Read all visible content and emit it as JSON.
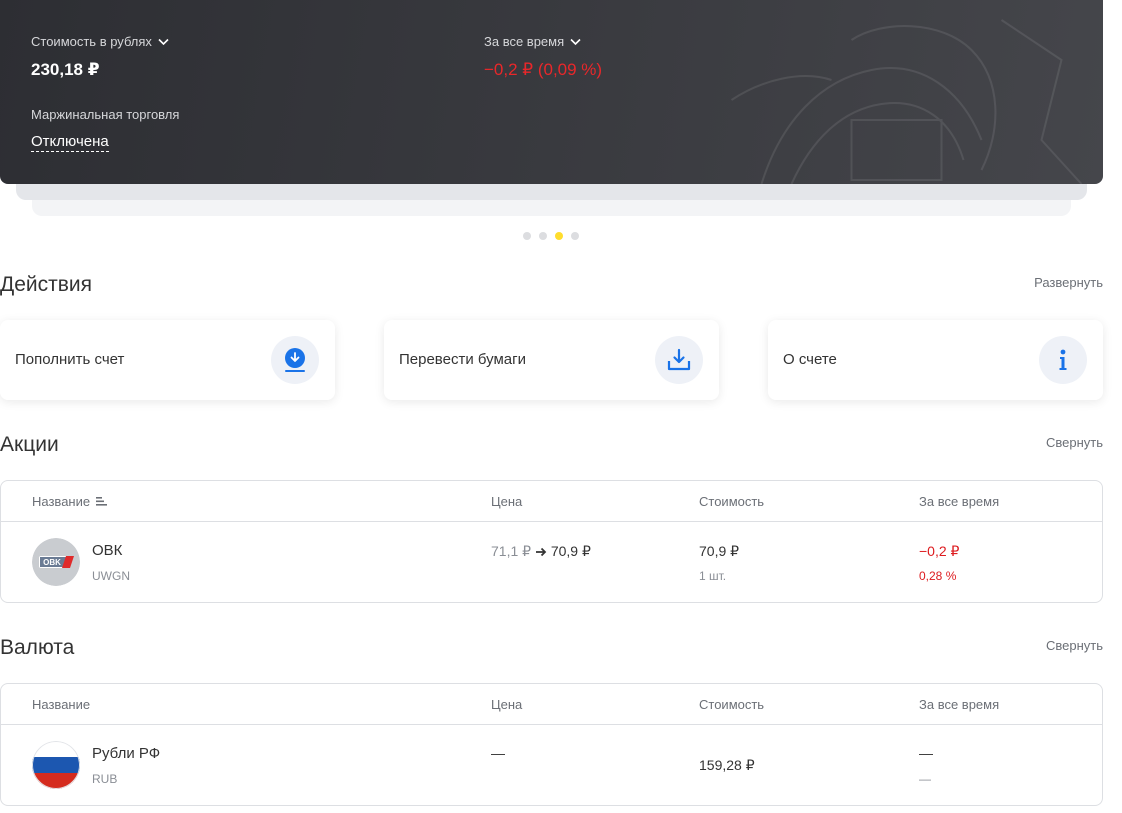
{
  "hero": {
    "value_label": "Стоимость в рублях",
    "value": "230,18 ₽",
    "period_label": "За все время",
    "period_change": "−0,2 ₽ (0,09 %)",
    "margin_label": "Маржинальная торговля",
    "margin_status": "Отключена"
  },
  "carousel": {
    "count": 4,
    "active_index": 2
  },
  "actions": {
    "title": "Действия",
    "toggle": "Развернуть",
    "items": [
      {
        "label": "Пополнить счет",
        "icon": "download-circle-icon"
      },
      {
        "label": "Перевести бумаги",
        "icon": "tray-download-icon"
      },
      {
        "label": "О счете",
        "icon": "info-icon"
      }
    ]
  },
  "stocks": {
    "title": "Акции",
    "toggle": "Свернуть",
    "columns": [
      "Название",
      "Цена",
      "Стоимость",
      "За все время"
    ],
    "rows": [
      {
        "name": "ОВК",
        "ticker": "UWGN",
        "logo_text": "OBK",
        "price_from": "71,1 ₽",
        "price_to": "70,9 ₽",
        "value": "70,9 ₽",
        "qty": "1 шт.",
        "change_abs": "−0,2 ₽",
        "change_pct": "0,28 %"
      }
    ]
  },
  "currency": {
    "title": "Валюта",
    "toggle": "Свернуть",
    "columns": [
      "Название",
      "Цена",
      "Стоимость",
      "За все время"
    ],
    "rows": [
      {
        "name": "Рубли РФ",
        "ticker": "RUB",
        "price": "—",
        "value": "159,28 ₽",
        "change_abs": "—",
        "change_pct": "—"
      }
    ]
  },
  "colors": {
    "accent": "#ffdd2d",
    "negative": "#dd1b1f",
    "icon_blue": "#1a73e8"
  }
}
